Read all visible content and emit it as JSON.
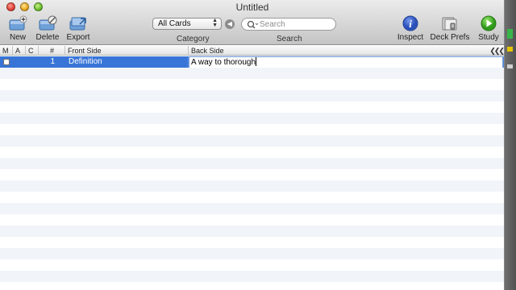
{
  "window": {
    "title": "Untitled"
  },
  "toolbar": {
    "new_label": "New",
    "delete_label": "Delete",
    "export_label": "Export",
    "category_label": "Category",
    "category_value": "All Cards",
    "search_label": "Search",
    "search_placeholder": "Search",
    "inspect_label": "Inspect",
    "deck_prefs_label": "Deck Prefs",
    "study_label": "Study"
  },
  "table": {
    "columns": [
      "M",
      "A",
      "C",
      "#",
      "Front Side",
      "Back Side"
    ],
    "rows": [
      {
        "number": "1",
        "front": "Definition",
        "back": "A way to thorough",
        "selected": true
      }
    ]
  },
  "colors": {
    "selection": "#3875d7",
    "stripe": "#f1f4f8"
  }
}
